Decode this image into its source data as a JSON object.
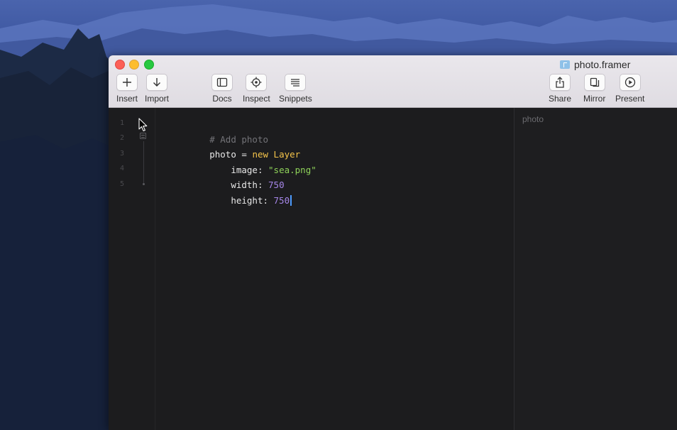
{
  "window": {
    "document_title": "photo.framer",
    "icons": {
      "document": "framer-file-icon"
    }
  },
  "toolbar": {
    "left": [
      {
        "id": "insert",
        "label": "Insert",
        "icon": "plus-icon"
      },
      {
        "id": "import",
        "label": "Import",
        "icon": "arrow-down-icon"
      }
    ],
    "middle": [
      {
        "id": "docs",
        "label": "Docs",
        "icon": "sidebar-icon"
      },
      {
        "id": "inspect",
        "label": "Inspect",
        "icon": "target-icon"
      },
      {
        "id": "snippets",
        "label": "Snippets",
        "icon": "list-lines-icon"
      }
    ],
    "right": [
      {
        "id": "share",
        "label": "Share",
        "icon": "share-icon"
      },
      {
        "id": "mirror",
        "label": "Mirror",
        "icon": "mirror-icon"
      },
      {
        "id": "present",
        "label": "Present",
        "icon": "play-circle-icon"
      }
    ]
  },
  "editor": {
    "line_numbers": [
      "1",
      "2",
      "3",
      "4",
      "5"
    ],
    "lines": [
      [
        {
          "t": "# Add photo",
          "k": "comment"
        }
      ],
      [
        {
          "t": "photo = ",
          "k": "plain"
        },
        {
          "t": "new Layer",
          "k": "kw"
        }
      ],
      [
        {
          "t": "    image: ",
          "k": "plain"
        },
        {
          "t": "\"sea.png\"",
          "k": "str"
        }
      ],
      [
        {
          "t": "    width: ",
          "k": "plain"
        },
        {
          "t": "750",
          "k": "num"
        }
      ],
      [
        {
          "t": "    height: ",
          "k": "plain"
        },
        {
          "t": "750",
          "k": "num"
        }
      ]
    ]
  },
  "preview": {
    "layer_name": "photo"
  },
  "colors": {
    "comment": "#737378",
    "keyword": "#f4c34a",
    "string": "#8fd35a",
    "number": "#a586e8",
    "caret": "#4d9bff"
  }
}
